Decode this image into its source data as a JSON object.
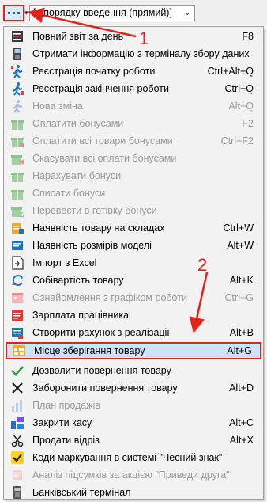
{
  "toolbar": {
    "sort_select": {
      "value": "[у порядку введення (прямий)]"
    }
  },
  "annotations": {
    "marker_1": "1",
    "marker_2": "2"
  },
  "colors": {
    "annotation_red": "#e2231a",
    "highlight_bg": "#cfe3f7",
    "menu_bg": "#f2f2f2"
  },
  "menu": {
    "items": [
      {
        "label": "Повний звіт за день",
        "shortcut": "F8",
        "icon": "report-icon",
        "enabled": true
      },
      {
        "label": "Отримати інформацію з терміналу збору даних",
        "shortcut": "",
        "icon": "terminal-icon",
        "enabled": true
      },
      {
        "label": "Реєстрація початку роботи",
        "shortcut": "Ctrl+Alt+Q",
        "icon": "work-start-icon",
        "enabled": true
      },
      {
        "label": "Реєстрація закінчення роботи",
        "shortcut": "Ctrl+Q",
        "icon": "work-end-icon",
        "enabled": true
      },
      {
        "label": "Нова зміна",
        "shortcut": "Alt+Q",
        "icon": "new-shift-icon",
        "enabled": false
      },
      {
        "label": "Оплатити бонусами",
        "shortcut": "F2",
        "icon": "gift-icon",
        "enabled": false
      },
      {
        "label": "Оплатити всі товари бонусами",
        "shortcut": "Ctrl+F2",
        "icon": "gift-all-icon",
        "enabled": false
      },
      {
        "label": "Скасувати всі оплати бонусами",
        "shortcut": "",
        "icon": "gift-cancel-icon",
        "enabled": false
      },
      {
        "label": "Нарахувати бонуси",
        "shortcut": "",
        "icon": "gift-accrue-icon",
        "enabled": false
      },
      {
        "label": "Списати бонуси",
        "shortcut": "",
        "icon": "gift-writeoff-icon",
        "enabled": false
      },
      {
        "label": "Перевести в готівку бонуси",
        "shortcut": "",
        "icon": "gift-cash-icon",
        "enabled": false
      },
      {
        "label": "Наявність товару на складах",
        "shortcut": "Ctrl+W",
        "icon": "stock-icon",
        "enabled": true
      },
      {
        "label": "Наявність розмірів моделі",
        "shortcut": "Alt+W",
        "icon": "sizes-icon",
        "enabled": true
      },
      {
        "label": "Імпорт з Excel",
        "shortcut": "",
        "icon": "excel-import-icon",
        "enabled": true
      },
      {
        "label": "Собівартість товару",
        "shortcut": "Alt+K",
        "icon": "cost-icon",
        "enabled": true
      },
      {
        "label": "Ознайомлення з графіком роботи",
        "shortcut": "Ctrl+G",
        "icon": "schedule-icon",
        "enabled": false
      },
      {
        "label": "Зарплата працівника",
        "shortcut": "",
        "icon": "salary-icon",
        "enabled": true
      },
      {
        "label": "Створити рахунок з реалізації",
        "shortcut": "Alt+B",
        "icon": "invoice-icon",
        "enabled": true
      },
      {
        "label": "Місце зберігання товару",
        "shortcut": "Alt+G",
        "icon": "storage-place-icon",
        "enabled": true,
        "highlighted": true
      },
      {
        "label": "Дозволити повернення товару",
        "shortcut": "",
        "icon": "checkmark-icon",
        "enabled": true
      },
      {
        "label": "Заборонити повернення товару",
        "shortcut": "Alt+D",
        "icon": "cross-icon",
        "enabled": true
      },
      {
        "label": "План продажів",
        "shortcut": "",
        "icon": "sales-plan-icon",
        "enabled": false
      },
      {
        "label": "Закрити касу",
        "shortcut": "Alt+C",
        "icon": "close-register-icon",
        "enabled": true
      },
      {
        "label": "Продати відріз",
        "shortcut": "Alt+X",
        "icon": "scissors-icon",
        "enabled": true
      },
      {
        "label": "Коди маркування в системі \"Чесний знак\"",
        "shortcut": "",
        "icon": "marking-codes-icon",
        "enabled": true
      },
      {
        "label": "Аналіз підсумків за акцією \"Приведи друга\"",
        "shortcut": "",
        "icon": "friend-promo-icon",
        "enabled": false
      },
      {
        "label": "Банківський термінал",
        "shortcut": "",
        "icon": "bank-terminal-icon",
        "enabled": true
      }
    ]
  }
}
